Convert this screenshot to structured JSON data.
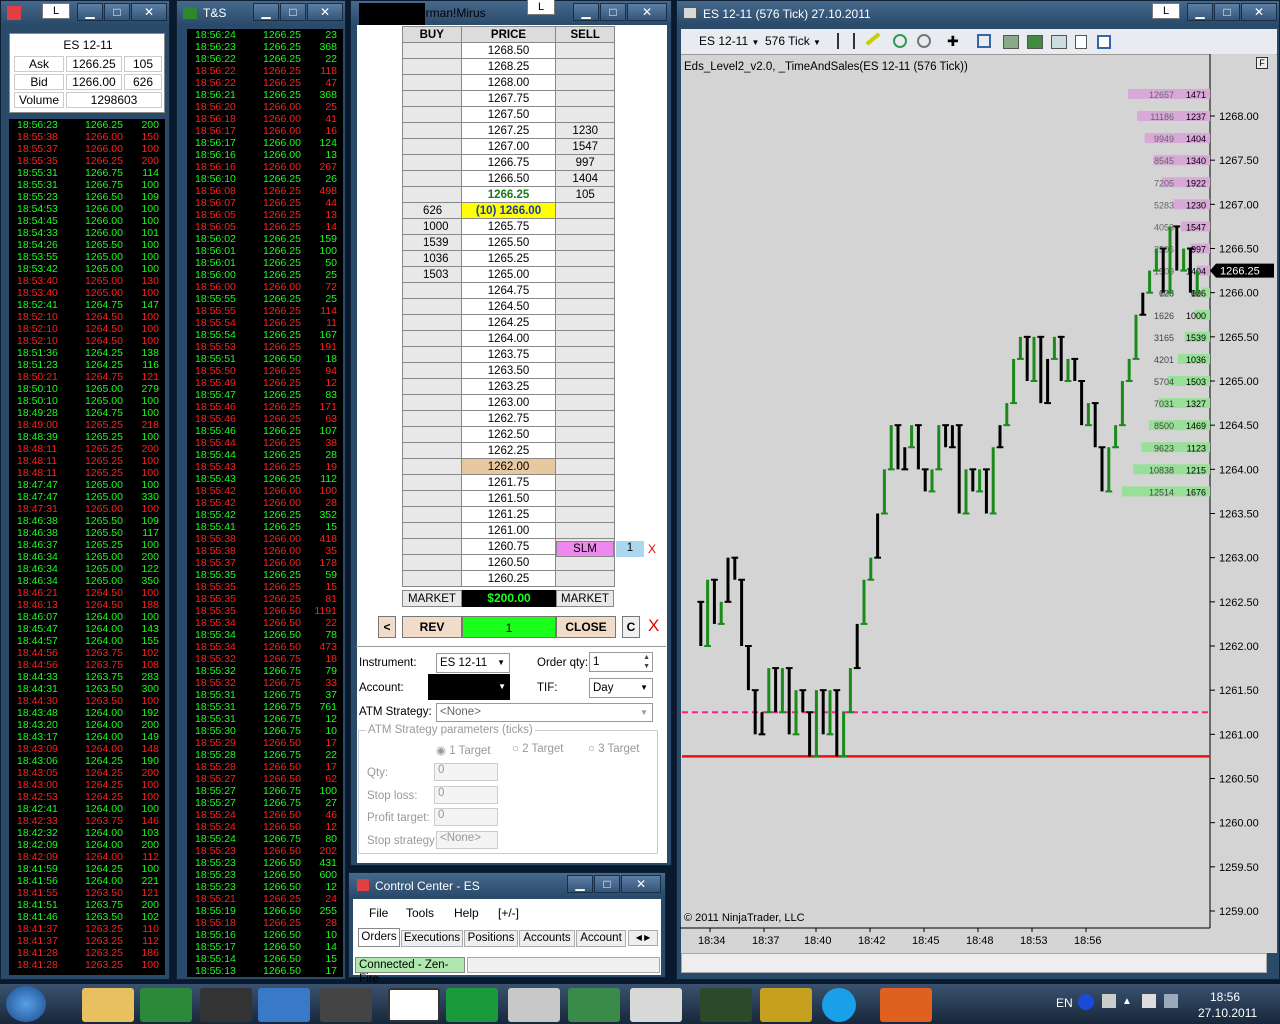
{
  "quote": {
    "instrument": "ES 12-11",
    "ask_label": "Ask",
    "ask_price": "1266.25",
    "ask_size": "105",
    "bid_label": "Bid",
    "bid_price": "1266.00",
    "bid_size": "626",
    "volume_label": "Volume",
    "volume": "1298603"
  },
  "ts_window": {
    "title": "T&S"
  },
  "ts1": [
    [
      "18:56:23",
      "1266.25",
      "200",
      "g"
    ],
    [
      "18:55:38",
      "1266.00",
      "150",
      "r"
    ],
    [
      "18:55:37",
      "1266.00",
      "100",
      "r"
    ],
    [
      "18:55:35",
      "1266.25",
      "200",
      "r"
    ],
    [
      "18:55:31",
      "1266.75",
      "114",
      "g"
    ],
    [
      "18:55:31",
      "1266.75",
      "100",
      "g"
    ],
    [
      "18:55:23",
      "1266.50",
      "109",
      "g"
    ],
    [
      "18:54:53",
      "1266.00",
      "100",
      "g"
    ],
    [
      "18:54:45",
      "1266.00",
      "100",
      "g"
    ],
    [
      "18:54:33",
      "1266.00",
      "101",
      "g"
    ],
    [
      "18:54:26",
      "1265.50",
      "100",
      "g"
    ],
    [
      "18:53:55",
      "1265.00",
      "100",
      "g"
    ],
    [
      "18:53:42",
      "1265.00",
      "100",
      "g"
    ],
    [
      "18:53:40",
      "1265.00",
      "130",
      "r"
    ],
    [
      "18:53:40",
      "1265.00",
      "100",
      "r"
    ],
    [
      "18:52:41",
      "1264.75",
      "147",
      "g"
    ],
    [
      "18:52:10",
      "1264.50",
      "100",
      "r"
    ],
    [
      "18:52:10",
      "1264.50",
      "100",
      "r"
    ],
    [
      "18:52:10",
      "1264.50",
      "100",
      "r"
    ],
    [
      "18:51:36",
      "1264.25",
      "138",
      "g"
    ],
    [
      "18:51:23",
      "1264.25",
      "116",
      "g"
    ],
    [
      "18:50:21",
      "1264.75",
      "121",
      "r"
    ],
    [
      "18:50:10",
      "1265.00",
      "279",
      "g"
    ],
    [
      "18:50:10",
      "1265.00",
      "100",
      "g"
    ],
    [
      "18:49:28",
      "1264.75",
      "100",
      "g"
    ],
    [
      "18:49:00",
      "1265.25",
      "218",
      "r"
    ],
    [
      "18:48:39",
      "1265.25",
      "100",
      "g"
    ],
    [
      "18:48:11",
      "1265.25",
      "200",
      "r"
    ],
    [
      "18:48:11",
      "1265.25",
      "100",
      "r"
    ],
    [
      "18:48:11",
      "1265.25",
      "100",
      "r"
    ],
    [
      "18:47:47",
      "1265.00",
      "100",
      "g"
    ],
    [
      "18:47:47",
      "1265.00",
      "330",
      "g"
    ],
    [
      "18:47:31",
      "1265.00",
      "100",
      "r"
    ],
    [
      "18:46:38",
      "1265.50",
      "109",
      "g"
    ],
    [
      "18:46:38",
      "1265.50",
      "117",
      "g"
    ],
    [
      "18:46:37",
      "1265.25",
      "100",
      "g"
    ],
    [
      "18:46:34",
      "1265.00",
      "200",
      "g"
    ],
    [
      "18:46:34",
      "1265.00",
      "122",
      "g"
    ],
    [
      "18:46:34",
      "1265.00",
      "350",
      "g"
    ],
    [
      "18:46:21",
      "1264.50",
      "100",
      "r"
    ],
    [
      "18:46:13",
      "1264.50",
      "188",
      "r"
    ],
    [
      "18:46:07",
      "1264.00",
      "100",
      "g"
    ],
    [
      "18:45:47",
      "1264.00",
      "143",
      "g"
    ],
    [
      "18:44:57",
      "1264.00",
      "155",
      "g"
    ],
    [
      "18:44:56",
      "1263.75",
      "102",
      "r"
    ],
    [
      "18:44:56",
      "1263.75",
      "108",
      "r"
    ],
    [
      "18:44:33",
      "1263.75",
      "283",
      "g"
    ],
    [
      "18:44:31",
      "1263.50",
      "300",
      "g"
    ],
    [
      "18:44:30",
      "1263.50",
      "100",
      "r"
    ],
    [
      "18:43:48",
      "1264.00",
      "192",
      "g"
    ],
    [
      "18:43:20",
      "1264.00",
      "200",
      "g"
    ],
    [
      "18:43:17",
      "1264.00",
      "149",
      "g"
    ],
    [
      "18:43:09",
      "1264.00",
      "148",
      "r"
    ],
    [
      "18:43:06",
      "1264.25",
      "190",
      "g"
    ],
    [
      "18:43:05",
      "1264.25",
      "200",
      "r"
    ],
    [
      "18:43:00",
      "1264.25",
      "100",
      "r"
    ],
    [
      "18:42:53",
      "1264.25",
      "100",
      "r"
    ],
    [
      "18:42:41",
      "1264.00",
      "100",
      "g"
    ],
    [
      "18:42:33",
      "1263.75",
      "146",
      "r"
    ],
    [
      "18:42:32",
      "1264.00",
      "103",
      "g"
    ],
    [
      "18:42:09",
      "1264.00",
      "200",
      "g"
    ],
    [
      "18:42:09",
      "1264.00",
      "112",
      "r"
    ],
    [
      "18:41:59",
      "1264.25",
      "100",
      "g"
    ],
    [
      "18:41:56",
      "1264.00",
      "221",
      "g"
    ],
    [
      "18:41:55",
      "1263.50",
      "121",
      "r"
    ],
    [
      "18:41:51",
      "1263.75",
      "200",
      "g"
    ],
    [
      "18:41:46",
      "1263.50",
      "102",
      "g"
    ],
    [
      "18:41:37",
      "1263.25",
      "110",
      "r"
    ],
    [
      "18:41:37",
      "1263.25",
      "112",
      "r"
    ],
    [
      "18:41:28",
      "1263.25",
      "186",
      "r"
    ],
    [
      "18:41:28",
      "1263.25",
      "100",
      "r"
    ]
  ],
  "ts2": [
    [
      "18:56:24",
      "1266.25",
      "23",
      "g"
    ],
    [
      "18:56:23",
      "1266.25",
      "368",
      "g"
    ],
    [
      "18:56:22",
      "1266.25",
      "22",
      "g"
    ],
    [
      "18:56:22",
      "1266.25",
      "118",
      "r"
    ],
    [
      "18:56:22",
      "1266.25",
      "47",
      "r"
    ],
    [
      "18:56:21",
      "1266.25",
      "368",
      "g"
    ],
    [
      "18:56:20",
      "1266.00",
      "25",
      "r"
    ],
    [
      "18:56:18",
      "1266.00",
      "41",
      "r"
    ],
    [
      "18:56:17",
      "1266.00",
      "16",
      "r"
    ],
    [
      "18:56:17",
      "1266.00",
      "124",
      "g"
    ],
    [
      "18:56:16",
      "1266.00",
      "13",
      "g"
    ],
    [
      "18:56:16",
      "1266.00",
      "267",
      "r"
    ],
    [
      "18:56:10",
      "1266.25",
      "26",
      "g"
    ],
    [
      "18:56:08",
      "1266.25",
      "498",
      "r"
    ],
    [
      "18:56:07",
      "1266.25",
      "44",
      "r"
    ],
    [
      "18:56:05",
      "1266.25",
      "13",
      "r"
    ],
    [
      "18:56:05",
      "1266.25",
      "14",
      "r"
    ],
    [
      "18:56:02",
      "1266.25",
      "159",
      "g"
    ],
    [
      "18:56:01",
      "1266.25",
      "100",
      "g"
    ],
    [
      "18:56:01",
      "1266.25",
      "50",
      "g"
    ],
    [
      "18:56:00",
      "1266.25",
      "25",
      "g"
    ],
    [
      "18:56:00",
      "1266.00",
      "72",
      "r"
    ],
    [
      "18:55:55",
      "1266.25",
      "25",
      "g"
    ],
    [
      "18:55:55",
      "1266.25",
      "114",
      "r"
    ],
    [
      "18:55:54",
      "1266.25",
      "11",
      "r"
    ],
    [
      "18:55:54",
      "1266.25",
      "167",
      "g"
    ],
    [
      "18:55:53",
      "1266.25",
      "191",
      "r"
    ],
    [
      "18:55:51",
      "1266.50",
      "18",
      "g"
    ],
    [
      "18:55:50",
      "1266.25",
      "94",
      "r"
    ],
    [
      "18:55:49",
      "1266.25",
      "12",
      "r"
    ],
    [
      "18:55:47",
      "1266.25",
      "83",
      "g"
    ],
    [
      "18:55:46",
      "1266.25",
      "171",
      "r"
    ],
    [
      "18:55:46",
      "1266.25",
      "63",
      "r"
    ],
    [
      "18:55:46",
      "1266.25",
      "107",
      "g"
    ],
    [
      "18:55:44",
      "1266.25",
      "38",
      "r"
    ],
    [
      "18:55:44",
      "1266.25",
      "28",
      "g"
    ],
    [
      "18:55:43",
      "1266.25",
      "19",
      "r"
    ],
    [
      "18:55:43",
      "1266.25",
      "112",
      "g"
    ],
    [
      "18:55:42",
      "1266.00",
      "100",
      "r"
    ],
    [
      "18:55:42",
      "1266.00",
      "28",
      "r"
    ],
    [
      "18:55:42",
      "1266.25",
      "352",
      "g"
    ],
    [
      "18:55:41",
      "1266.25",
      "15",
      "g"
    ],
    [
      "18:55:38",
      "1266.00",
      "418",
      "r"
    ],
    [
      "18:55:38",
      "1266.00",
      "35",
      "r"
    ],
    [
      "18:55:37",
      "1266.00",
      "178",
      "r"
    ],
    [
      "18:55:35",
      "1266.25",
      "59",
      "g"
    ],
    [
      "18:55:35",
      "1266.25",
      "15",
      "r"
    ],
    [
      "18:55:35",
      "1266.25",
      "81",
      "r"
    ],
    [
      "18:55:35",
      "1266.50",
      "1191",
      "r"
    ],
    [
      "18:55:34",
      "1266.50",
      "22",
      "r"
    ],
    [
      "18:55:34",
      "1266.50",
      "78",
      "g"
    ],
    [
      "18:55:34",
      "1266.50",
      "473",
      "r"
    ],
    [
      "18:55:32",
      "1266.75",
      "18",
      "r"
    ],
    [
      "18:55:32",
      "1266.75",
      "79",
      "g"
    ],
    [
      "18:55:32",
      "1266.75",
      "33",
      "r"
    ],
    [
      "18:55:31",
      "1266.75",
      "37",
      "g"
    ],
    [
      "18:55:31",
      "1266.75",
      "761",
      "g"
    ],
    [
      "18:55:31",
      "1266.75",
      "12",
      "g"
    ],
    [
      "18:55:30",
      "1266.75",
      "10",
      "g"
    ],
    [
      "18:55:29",
      "1266.50",
      "17",
      "r"
    ],
    [
      "18:55:28",
      "1266.75",
      "22",
      "g"
    ],
    [
      "18:55:28",
      "1266.50",
      "17",
      "r"
    ],
    [
      "18:55:27",
      "1266.50",
      "62",
      "r"
    ],
    [
      "18:55:27",
      "1266.75",
      "100",
      "g"
    ],
    [
      "18:55:27",
      "1266.75",
      "27",
      "g"
    ],
    [
      "18:55:24",
      "1266.50",
      "46",
      "r"
    ],
    [
      "18:55:24",
      "1266.50",
      "12",
      "r"
    ],
    [
      "18:55:24",
      "1266.75",
      "80",
      "g"
    ],
    [
      "18:55:23",
      "1266.50",
      "202",
      "r"
    ],
    [
      "18:55:23",
      "1266.50",
      "431",
      "g"
    ],
    [
      "18:55:23",
      "1266.50",
      "600",
      "g"
    ],
    [
      "18:55:23",
      "1266.50",
      "12",
      "g"
    ],
    [
      "18:55:21",
      "1266.25",
      "24",
      "r"
    ],
    [
      "18:55:19",
      "1266.50",
      "255",
      "g"
    ],
    [
      "18:55:18",
      "1266.25",
      "28",
      "r"
    ],
    [
      "18:55:16",
      "1266.50",
      "10",
      "g"
    ],
    [
      "18:55:17",
      "1266.50",
      "14",
      "g"
    ],
    [
      "18:55:14",
      "1266.50",
      "15",
      "g"
    ],
    [
      "18:55:13",
      "1266.50",
      "17",
      "g"
    ]
  ],
  "dom": {
    "title_suffix": "orman!Mirus",
    "header": {
      "buy": "BUY",
      "price": "PRICE",
      "sell": "SELL"
    },
    "rows": [
      [
        "",
        "1268.50",
        ""
      ],
      [
        "",
        "1268.25",
        ""
      ],
      [
        "",
        "1268.00",
        ""
      ],
      [
        "",
        "1267.75",
        ""
      ],
      [
        "",
        "1267.50",
        ""
      ],
      [
        "",
        "1267.25",
        "1230"
      ],
      [
        "",
        "1267.00",
        "1547"
      ],
      [
        "",
        "1266.75",
        "997"
      ],
      [
        "",
        "1266.50",
        "1404"
      ],
      [
        "",
        "1266.25",
        "105"
      ],
      [
        "626",
        "(10) 1266.00",
        ""
      ],
      [
        "1000",
        "1265.75",
        ""
      ],
      [
        "1539",
        "1265.50",
        ""
      ],
      [
        "1036",
        "1265.25",
        ""
      ],
      [
        "1503",
        "1265.00",
        ""
      ],
      [
        "",
        "1264.75",
        ""
      ],
      [
        "",
        "1264.50",
        ""
      ],
      [
        "",
        "1264.25",
        ""
      ],
      [
        "",
        "1264.00",
        ""
      ],
      [
        "",
        "1263.75",
        ""
      ],
      [
        "",
        "1263.50",
        ""
      ],
      [
        "",
        "1263.25",
        ""
      ],
      [
        "",
        "1263.00",
        ""
      ],
      [
        "",
        "1262.75",
        ""
      ],
      [
        "",
        "1262.50",
        ""
      ],
      [
        "",
        "1262.25",
        ""
      ],
      [
        "",
        "1262.00",
        ""
      ],
      [
        "",
        "1261.75",
        ""
      ],
      [
        "",
        "1261.50",
        ""
      ],
      [
        "",
        "1261.25",
        ""
      ],
      [
        "",
        "1261.00",
        ""
      ],
      [
        "",
        "1260.75",
        ""
      ],
      [
        "",
        "1260.50",
        ""
      ],
      [
        "",
        "1260.25",
        ""
      ]
    ],
    "last_price": "1266.25",
    "position_price": "(10) 1266.00",
    "entry_price": "1262.00",
    "stop_price": "1260.75",
    "stop_label": "SLM",
    "stop_qty": "1",
    "stop_cancel": "X",
    "market_buy": "MARKET",
    "pnl": "$200.00",
    "market_sell": "MARKET",
    "rev": "REV",
    "qty": "1",
    "close": "CLOSE",
    "btn_left": "<",
    "btn_c": "C",
    "btn_x": "X"
  },
  "form": {
    "instrument_label": "Instrument:",
    "instrument": "ES 12-11",
    "order_qty_label": "Order qty:",
    "order_qty": "1",
    "account_label": "Account:",
    "tif_label": "TIF:",
    "tif": "Day",
    "atm_label": "ATM Strategy:",
    "atm": "<None>",
    "params_label": "ATM Strategy parameters (ticks)",
    "target1": "1 Target",
    "target2": "2 Target",
    "target3": "3 Target",
    "qty_label": "Qty:",
    "qty": "0",
    "stop_label": "Stop loss:",
    "stop": "0",
    "profit_label": "Profit target:",
    "profit": "0",
    "stopstrat_label": "Stop strategy:",
    "stopstrat": "<None>"
  },
  "cc": {
    "title": "Control Center - ES",
    "menu": [
      "File",
      "Tools",
      "Help",
      "[+/-]"
    ],
    "tabs": [
      "Orders",
      "Executions",
      "Positions",
      "Accounts",
      "Account"
    ],
    "status": "Connected - Zen-Fire"
  },
  "chart": {
    "title": "ES 12-11 (576 Tick)  27.10.2011",
    "instrument": "ES 12-11",
    "interval": "576 Tick",
    "indicator": "Eds_Level2_v2.0, _TimeAndSales(ES 12-11 (576 Tick))",
    "copyright": "© 2011 NinjaTrader, LLC",
    "last_price": "1266.25",
    "f_label": "F",
    "y_labels": [
      "1268.00",
      "1267.50",
      "1267.00",
      "1266.50",
      "1266.00",
      "1265.50",
      "1265.00",
      "1264.50",
      "1264.00",
      "1263.50",
      "1263.00",
      "1262.50",
      "1262.00",
      "1261.50",
      "1261.00",
      "1260.50",
      "1260.00",
      "1259.50",
      "1259.00"
    ],
    "x_labels": [
      "18:34",
      "18:37",
      "18:40",
      "18:42",
      "18:45",
      "18:48",
      "18:53",
      "18:56"
    ],
    "ask_levels": [
      [
        "12657",
        "1471"
      ],
      [
        "11186",
        "1237"
      ],
      [
        "9949",
        "1404"
      ],
      [
        "8545",
        "1340"
      ],
      [
        "7205",
        "1922"
      ],
      [
        "5283",
        "1230"
      ],
      [
        "4053",
        "1547"
      ],
      [
        "2506",
        "997"
      ],
      [
        "1509",
        "1404"
      ],
      [
        "105",
        "105"
      ]
    ],
    "bid_levels": [
      [
        "626",
        "626"
      ],
      [
        "1626",
        "1000"
      ],
      [
        "3165",
        "1539"
      ],
      [
        "4201",
        "1036"
      ],
      [
        "5704",
        "1503"
      ],
      [
        "7031",
        "1327"
      ],
      [
        "8500",
        "1469"
      ],
      [
        "9623",
        "1123"
      ],
      [
        "10838",
        "1215"
      ],
      [
        "12514",
        "1676"
      ]
    ],
    "colors": {
      "up": "#1a8a1a",
      "down": "#000000",
      "stop": "#ff2090",
      "entry": "#ee1111",
      "ask": "#d8a8d8",
      "bid": "#98e098"
    }
  },
  "taskbar": {
    "lang": "EN",
    "time": "18:56",
    "date": "27.10.2011"
  },
  "window_btns": {
    "min": "▁",
    "max": "□",
    "close": "✕",
    "l": "L"
  }
}
